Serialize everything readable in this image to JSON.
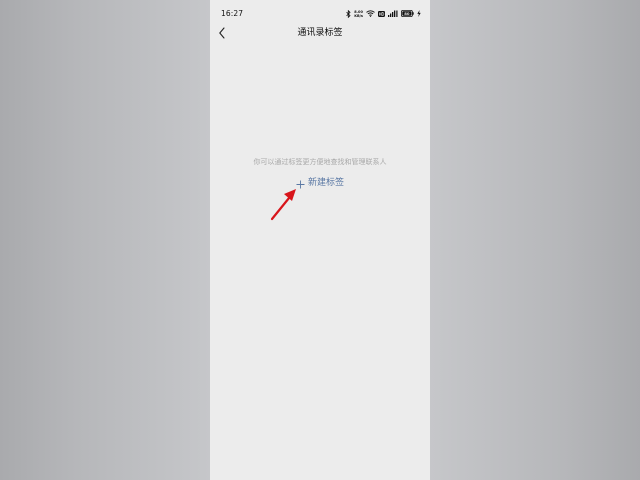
{
  "status_bar": {
    "time": "16:27",
    "net_speed_value": "8.00",
    "net_speed_unit": "KB/s",
    "icons": [
      "bluetooth-icon",
      "net-speed-icon",
      "wifi-icon",
      "hd-icon",
      "signal-icon",
      "battery-icon",
      "charging-icon"
    ],
    "battery_level": "80"
  },
  "header": {
    "back_icon": "chevron-left-icon",
    "title": "通讯录标签"
  },
  "main": {
    "empty_hint": "你可以通过标签更方便地查找和管理联系人",
    "new_tag_label": "新建标签",
    "new_tag_icon": "plus-icon"
  },
  "annotation": {
    "arrow_color": "#d8151b"
  },
  "colors": {
    "accent": "#5a78a4",
    "hint_text": "#a8a8a8",
    "page_background": "#ececec"
  }
}
